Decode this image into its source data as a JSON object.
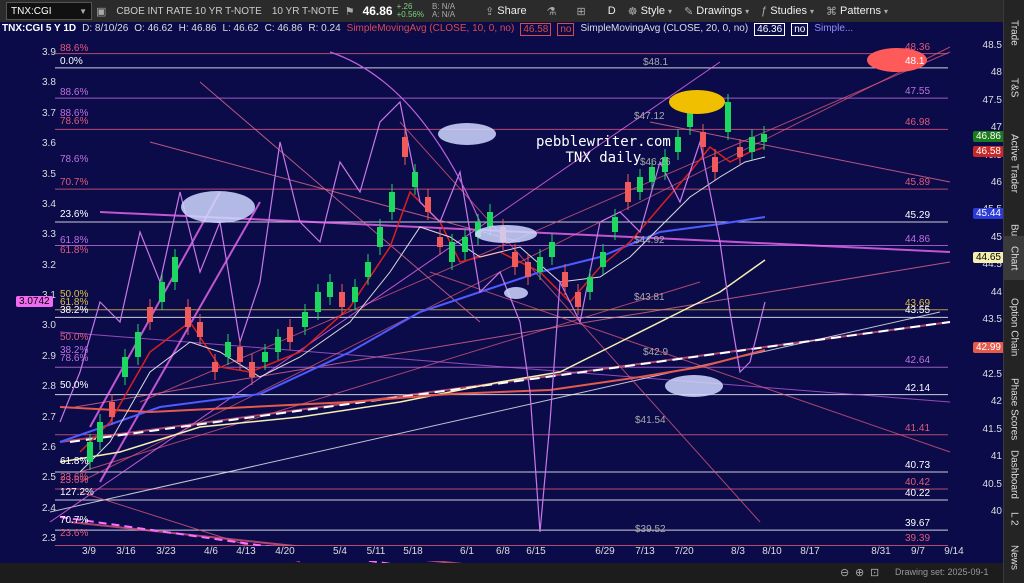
{
  "toolbar": {
    "symbol": "TNX:CGI",
    "description": "CBOE INT RATE 10 YR T-NOTE",
    "description2": "10 YR T-NOTE",
    "last": "46.86",
    "change": "+.26",
    "change_pct": "+0.56%",
    "bid": "B: N/A",
    "ask": "A: N/A",
    "share": "Share",
    "period": "D",
    "style": "Style",
    "drawings": "Drawings",
    "studies": "Studies",
    "patterns": "Patterns"
  },
  "chart_header": {
    "symbol": "TNX:CGI 5 Y 1D",
    "date": "D: 8/10/26",
    "open": "O: 46.62",
    "high": "H: 46.86",
    "low": "L: 46.62",
    "close": "C: 46.86",
    "range": "R: 0.24",
    "ma1": "SimpleMovingAvg (CLOSE, 10, 0, no)",
    "ma1_val": "46.58",
    "ma1_flag": "no",
    "ma2": "SimpleMovingAvg (CLOSE, 20, 0, no)",
    "ma2_val": "46.36",
    "ma2_flag": "no",
    "ma3": "Simple..."
  },
  "annotation": {
    "line1": "pebblewriter.com",
    "line2": "TNX daily"
  },
  "y_axis_right": [
    "48.5",
    "48",
    "47.5",
    "47",
    "46.5",
    "46",
    "45.5",
    "45",
    "44.5",
    "44",
    "43.5",
    "43",
    "42.5",
    "42",
    "41.5",
    "41",
    "40.5",
    "40"
  ],
  "y_axis_left": [
    "3.9",
    "3.8",
    "3.7",
    "3.6",
    "3.5",
    "3.4",
    "3.3",
    "3.2",
    "3.1",
    "3.0",
    "2.9",
    "2.8",
    "2.7",
    "2.6",
    "2.5",
    "2.4",
    "2.3"
  ],
  "price_tags": {
    "last": "46.86",
    "ma10": "46.58",
    "ma50": "45.44",
    "ma100": "44.65",
    "ma200": "42.99",
    "left": "3.0742"
  },
  "fib_labels_left": [
    "88.6%",
    "0.0%",
    "88.6%",
    "88.6%",
    "78.6%",
    "78.6%",
    "70.7%",
    "23.6%",
    "61.8%",
    "61.8%",
    "50.0%",
    "61.8%",
    "38.2%",
    "50.0%",
    "38.2%",
    "78.6%",
    "50.0%",
    "23.6%",
    "61.8%",
    "23.6%",
    "127.2%",
    "70.7%",
    "23.6%"
  ],
  "fib_labels_right": [
    "48.36",
    "48.1",
    "47.55",
    "46.98",
    "45.89",
    "45.29",
    "44.86",
    "43.69",
    "43.55",
    "42.64",
    "42.14",
    "41.41",
    "40.73",
    "40.42",
    "40.22",
    "39.67",
    "39.39"
  ],
  "fib_labels_mid": [
    "$48.1",
    "$47.12",
    "$46.26",
    "$44.92",
    "$43.81",
    "$42.9",
    "$41.54",
    "$39.52"
  ],
  "x_axis": [
    "3/9",
    "3/16",
    "3/23",
    "4/6",
    "4/13",
    "4/20",
    "5/4",
    "5/11",
    "5/18",
    "6/1",
    "6/8",
    "6/15",
    "6/29",
    "7/13",
    "7/20",
    "8/3",
    "8/10",
    "8/17",
    "8/31",
    "9/7",
    "9/14"
  ],
  "bottom_bar": {
    "drawing_set": "Drawing set: 2025-09-1"
  },
  "sidebar": [
    "Trade",
    "T&S",
    "Active Trader",
    "Buttons",
    "Chart",
    "Option Chain",
    "Phase Scores",
    "Dashboard",
    "L 2",
    "News"
  ],
  "colors": {
    "chart_bg": "#0b0b4a",
    "up": "#1ed760",
    "down": "#f05a5a",
    "fib": "#d0507a",
    "violet": "#c060e0"
  }
}
